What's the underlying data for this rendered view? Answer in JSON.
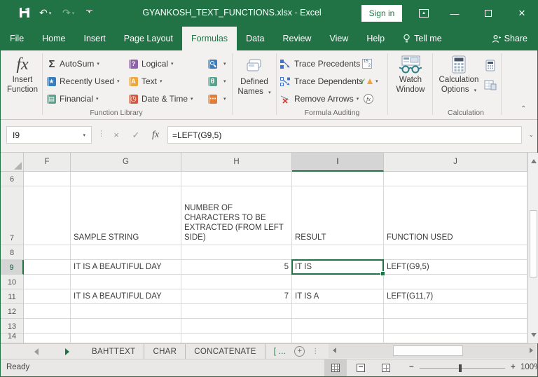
{
  "titlebar": {
    "title": "GYANKOSH_TEXT_FUNCTIONS.xlsx - Excel",
    "sign_in_label": "Sign in"
  },
  "ribbon_tabs": [
    {
      "label": "File",
      "active": false
    },
    {
      "label": "Home",
      "active": false
    },
    {
      "label": "Insert",
      "active": false
    },
    {
      "label": "Page Layout",
      "active": false
    },
    {
      "label": "Formulas",
      "active": true
    },
    {
      "label": "Data",
      "active": false
    },
    {
      "label": "Review",
      "active": false
    },
    {
      "label": "View",
      "active": false
    },
    {
      "label": "Help",
      "active": false
    },
    {
      "label": "Tell me",
      "active": false,
      "icon": "lightbulb-icon"
    }
  ],
  "share_label": "Share",
  "ribbon": {
    "insert_function": {
      "line1": "Insert",
      "line2": "Function"
    },
    "function_library": {
      "group_label": "Function Library",
      "buttons": [
        {
          "label": "AutoSum",
          "icon": "sigma-icon"
        },
        {
          "label": "Recently Used",
          "icon": "star-icon"
        },
        {
          "label": "Financial",
          "icon": "financial-book-icon"
        },
        {
          "label": "Logical",
          "icon": "question-mark-icon"
        },
        {
          "label": "Text",
          "icon": "letter-a-icon"
        },
        {
          "label": "Date & Time",
          "icon": "clock-icon"
        }
      ],
      "compact_icons": [
        "lookup-reference-icon",
        "math-trig-icon",
        "more-functions-icon"
      ]
    },
    "defined_names": {
      "line1": "Defined",
      "line2": "Names"
    },
    "formula_auditing": {
      "group_label": "Formula Auditing",
      "buttons": [
        {
          "label": "Trace Precedents"
        },
        {
          "label": "Trace Dependents"
        },
        {
          "label": "Remove Arrows"
        }
      ]
    },
    "watch_window": {
      "line1": "Watch",
      "line2": "Window"
    },
    "calculation": {
      "group_label": "Calculation",
      "options_line1": "Calculation",
      "options_line2": "Options"
    }
  },
  "formula_bar": {
    "name_box_value": "I9",
    "formula": "=LEFT(G9,5)"
  },
  "grid": {
    "column_headers": [
      "F",
      "G",
      "H",
      "I",
      "J"
    ],
    "selected_column": "I",
    "selected_row": "9",
    "selected_cell": "I9",
    "rows": [
      {
        "n": "6",
        "cells": [
          "",
          "",
          "",
          "",
          ""
        ]
      },
      {
        "n": "7",
        "cells": [
          "",
          "SAMPLE STRING",
          "NUMBER OF CHARACTERS TO BE EXTRACTED (FROM LEFT SIDE)",
          "RESULT",
          "FUNCTION USED"
        ]
      },
      {
        "n": "8",
        "cells": [
          "",
          "",
          "",
          "",
          ""
        ]
      },
      {
        "n": "9",
        "cells": [
          "",
          "IT IS A BEAUTIFUL DAY",
          "5",
          "IT IS",
          "LEFT(G9,5)"
        ]
      },
      {
        "n": "10",
        "cells": [
          "",
          "",
          "",
          "",
          ""
        ]
      },
      {
        "n": "11",
        "cells": [
          "",
          "IT IS A BEAUTIFUL DAY",
          "7",
          "IT IS A",
          "LEFT(G11,7)"
        ]
      },
      {
        "n": "12",
        "cells": [
          "",
          "",
          "",
          "",
          ""
        ]
      },
      {
        "n": "13",
        "cells": [
          "",
          "",
          "",
          "",
          ""
        ]
      },
      {
        "n": "14",
        "cells": [
          "",
          "",
          "",
          "",
          ""
        ]
      }
    ]
  },
  "sheet_bar": {
    "tabs": [
      "BAHTTEXT",
      "CHAR",
      "CONCATENATE"
    ],
    "active_tab_truncated": "[ ...",
    "new_sheet_label": "+"
  },
  "status_bar": {
    "mode": "Ready",
    "zoom": "100%"
  },
  "colors": {
    "excel_green": "#217346",
    "ribbon_bg": "#f2f1ef",
    "selection_border": "#217346"
  }
}
